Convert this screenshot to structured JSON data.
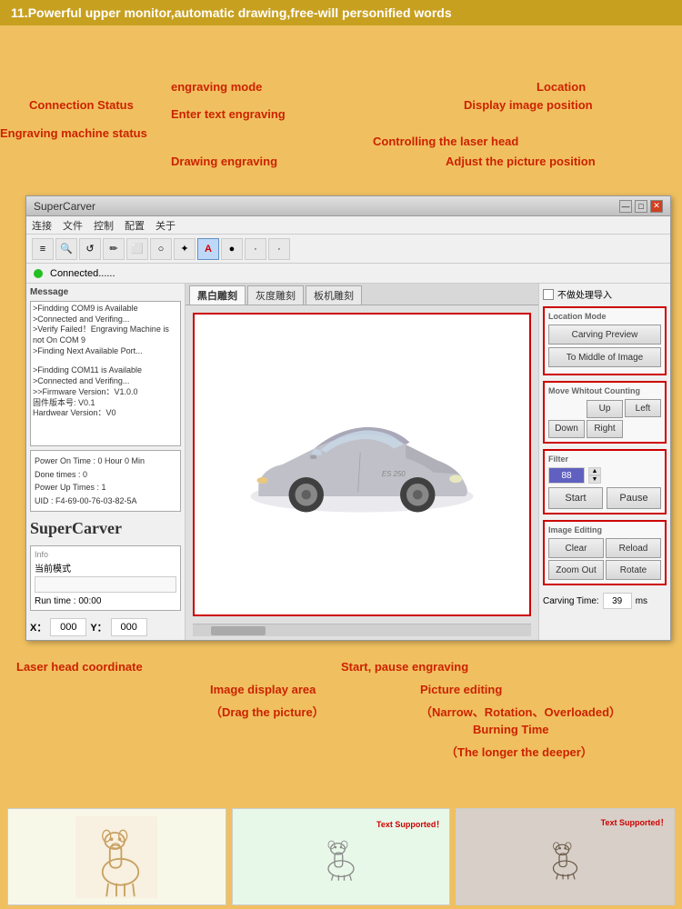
{
  "banner": {
    "text": "11.Powerful upper monitor,automatic drawing,free-will personified words"
  },
  "annotations": {
    "connection_status": "Connection Status",
    "engraving_machine_status": "Engraving machine status",
    "engraving_mode": "engraving mode",
    "enter_text_engraving": "Enter text engraving",
    "drawing_engraving": "Drawing engraving",
    "controlling_laser": "Controlling the laser head",
    "location": "Location",
    "display_image_position": "Display image position",
    "adjust_picture_position": "Adjust the picture position",
    "image_display_area": "Image display area",
    "drag_the_picture": "（Drag the picture）",
    "start_pause_engraving": "Start, pause engraving",
    "picture_editing": "Picture editing",
    "narrow_rotation": "（Narrow、Rotation、Overloaded）",
    "burning_time": "Burning Time",
    "longer_deeper": "（The longer the deeper）",
    "laser_head_coordinate": "Laser head coordinate"
  },
  "window": {
    "title": "SuperCarver",
    "menu": [
      "连接",
      "文件",
      "控制",
      "配置",
      "关于"
    ],
    "status_text": "Connected......",
    "no_process_label": "不做处理导入"
  },
  "toolbar_buttons": [
    "≡",
    "🔍",
    "↺",
    "✏",
    "⬜",
    "○",
    "✦",
    "A",
    "●",
    "·",
    "·"
  ],
  "tabs": [
    "黑白雕刻",
    "灰度雕刻",
    "板机雕刻"
  ],
  "left_panel": {
    "message_label": "Message",
    "messages": [
      ">Findding COM9 is Available",
      ">Connected and Verifing...",
      ">Verify Failed！Engraving Machine is not On COM 9",
      ">Finding Next Available Port...",
      "",
      ">Findding COM11 is Available",
      ">Connected and Verifing...",
      ">>Firmware Version：V1.0.0",
      "固件版本号: V0.1",
      "Hardwear Version：V0"
    ],
    "power_on_time": "Power On Time : 0 Hour 0 Min",
    "done_times": "Done times : 0",
    "power_up_times": "Power Up Times : 1",
    "uid": "UID : F4-69-00-76-03-82-5A",
    "logo": "SuperCarver",
    "info_label": "Info",
    "mode_label": "当前模式",
    "run_time_label": "Run time :",
    "run_time_value": "00:00",
    "x_label": "X：",
    "x_value": "000",
    "y_label": "Y：",
    "y_value": "000"
  },
  "right_panel": {
    "location_mode_title": "Location Mode",
    "carving_preview_btn": "Carving Preview",
    "to_middle_btn": "To Middle of Image",
    "move_title": "Move Whitout Counting",
    "up_btn": "Up",
    "left_btn": "Left",
    "down_btn": "Down",
    "right_btn": "Right",
    "filter_title": "Filter",
    "filter_value": "88",
    "start_btn": "Start",
    "pause_btn": "Pause",
    "image_editing_title": "Image Editing",
    "clear_btn": "Clear",
    "reload_btn": "Reload",
    "zoom_out_btn": "Zoom Out",
    "rotate_btn": "Rotate",
    "carving_time_label": "Carving Time:",
    "carving_time_value": "39",
    "ms_label": "ms"
  },
  "bottom_thumbs": [
    {
      "type": "giraffe",
      "label": ""
    },
    {
      "type": "app_screenshot",
      "label": "Text Supported！"
    },
    {
      "type": "engraved",
      "label": "Text Supported！"
    }
  ]
}
